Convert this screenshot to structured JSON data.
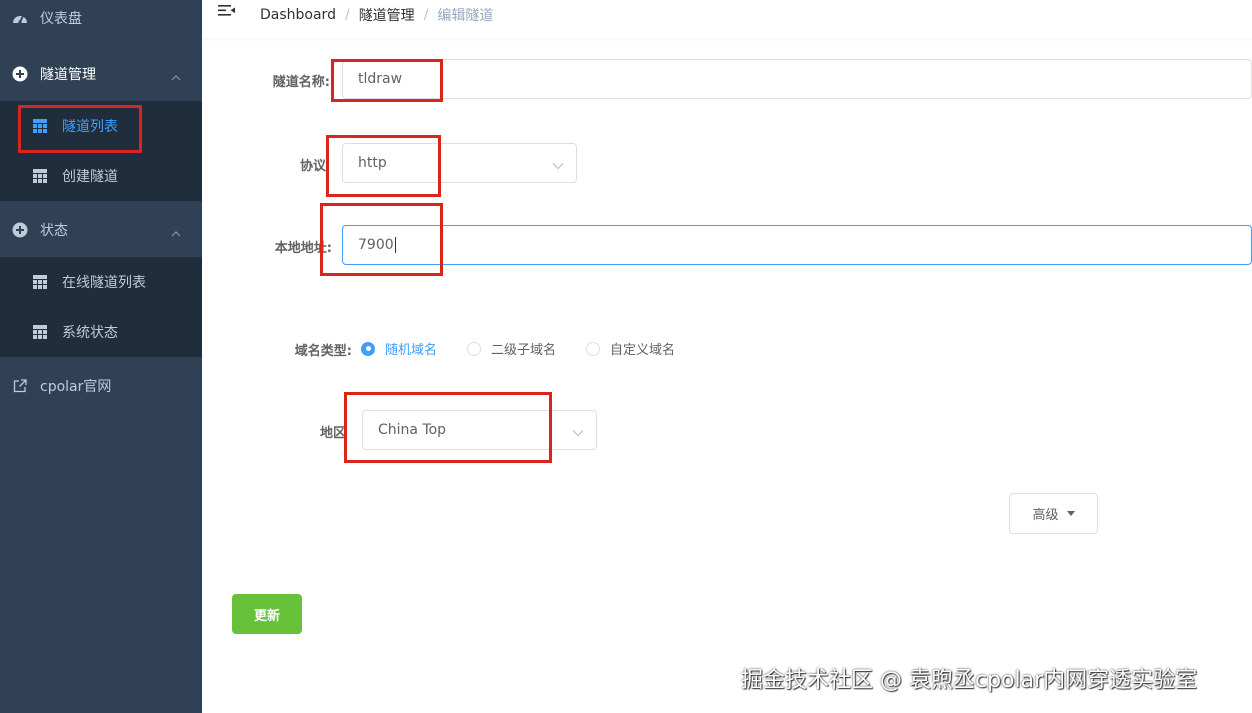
{
  "sidebar": {
    "dashboard": {
      "label": "仪表盘",
      "icon": "dashboard-icon"
    },
    "tunnel_mgmt": {
      "label": "隧道管理",
      "icon": "circle-plus-icon"
    },
    "tunnel_list": {
      "label": "隧道列表",
      "icon": "grid-icon"
    },
    "create_tunnel": {
      "label": "创建隧道",
      "icon": "grid-icon"
    },
    "status": {
      "label": "状态",
      "icon": "circle-plus-icon"
    },
    "online_tunnels": {
      "label": "在线隧道列表",
      "icon": "grid-icon"
    },
    "system_status": {
      "label": "系统状态",
      "icon": "grid-icon"
    },
    "official_site": {
      "label": "cpolar官网",
      "icon": "external-link-icon"
    }
  },
  "header": {
    "breadcrumb": [
      "Dashboard",
      "隧道管理",
      "编辑隧道"
    ],
    "separator": "/"
  },
  "form": {
    "tunnel_name": {
      "label": "隧道名称:",
      "value": "tldraw"
    },
    "protocol": {
      "label": "协议",
      "value": "http"
    },
    "local_address": {
      "label": "本地地址:",
      "value": "7900"
    },
    "domain_type": {
      "label": "域名类型:",
      "options": [
        "随机域名",
        "二级子域名",
        "自定义域名"
      ],
      "selected": "随机域名"
    },
    "region": {
      "label": "地区",
      "value": "China Top"
    },
    "advanced_label": "高级",
    "update_label": "更新"
  },
  "watermark": "掘金技术社区 @ 袁煦丞cpolar内网穿透实验室",
  "colors": {
    "sidebar_bg": "#304156",
    "submenu_bg": "#1f2d3d",
    "active": "#409eff",
    "success": "#67c23a",
    "highlight_box": "#d9261c"
  }
}
